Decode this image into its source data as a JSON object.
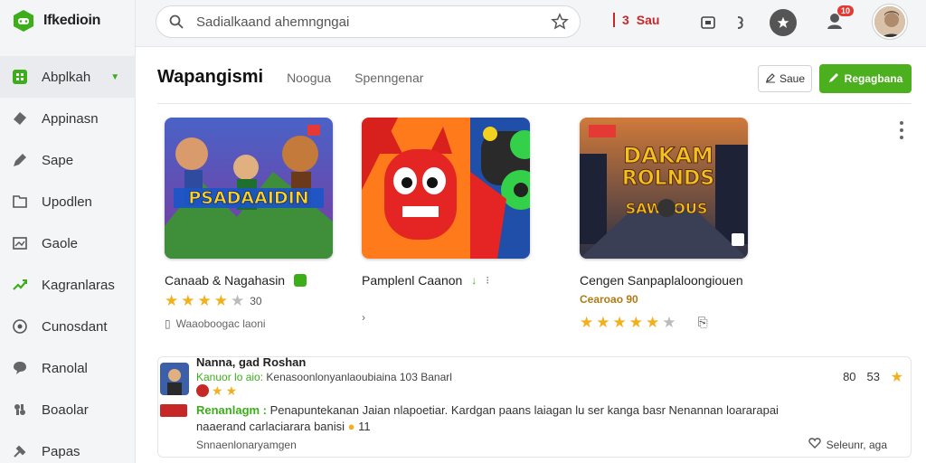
{
  "app": {
    "name": "Ifkedioin",
    "icons": {
      "logo": "controller-logo-icon"
    }
  },
  "sidebar": {
    "items": [
      {
        "label": "Abplkah",
        "icon": "grid-icon",
        "active": true
      },
      {
        "label": "Appinasn",
        "icon": "diamond-icon"
      },
      {
        "label": "Sape",
        "icon": "tag-icon"
      },
      {
        "label": "Upodlen",
        "icon": "folder-icon"
      },
      {
        "label": "Gaole",
        "icon": "image-icon"
      },
      {
        "label": "Kagranlaras",
        "icon": "trend-icon"
      },
      {
        "label": "Cunosdant",
        "icon": "globe-icon"
      },
      {
        "label": "Ranolal",
        "icon": "chat-icon"
      },
      {
        "label": "Boaolar",
        "icon": "puzzle-icon"
      },
      {
        "label": "Papas",
        "icon": "tools-icon"
      }
    ]
  },
  "topbar": {
    "search_placeholder": "Sadialkaand ahemngngai",
    "credits_value": "3",
    "credits_label": "Sau",
    "notification_badge": "10"
  },
  "main": {
    "tabs": [
      {
        "label": "Wapangismi",
        "active": true
      },
      {
        "label": "Noogua"
      },
      {
        "label": "Spenngenar"
      }
    ],
    "ghost_button": "Saue",
    "primary_button": "Regagbana",
    "cards": [
      {
        "title": "Canaab & Nagahasin",
        "rating_text": "30",
        "rating_stars": 4,
        "meta": "Waaoboogac laoni",
        "thumb_text": "PSADAAIDIN"
      },
      {
        "title": "Pamplenl Caanon",
        "rating_text": "",
        "rating_stars": 0,
        "meta": ""
      },
      {
        "title": "Cengen Sanpaplaloongiouen",
        "rating_text": "Cearoao 90",
        "rating_stars": 5,
        "meta": "",
        "thumb_text_1": "DAKAM",
        "thumb_text_2": "ROLNDS",
        "thumb_text_3": "SAWIJOUS"
      }
    ]
  },
  "review": {
    "name": "Nanna, gad Roshan",
    "line1_prefix": "Kanuor lo aio:",
    "line1_rest": "Kenasoonlonyanlaoubiaina 103 Banarl",
    "score_a": "80",
    "score_b": "53",
    "highlight": "Renanlagm :",
    "text": "Penapuntekanan Jaian nlapoetiar. Kardgan paans laiagan lu ser kanga basr Nenannan loararapai naaerand carlaciarara banisi",
    "text_count": "11",
    "footer": "Snnaenlonaryamgen",
    "like_label": "Seleunr, aga"
  }
}
